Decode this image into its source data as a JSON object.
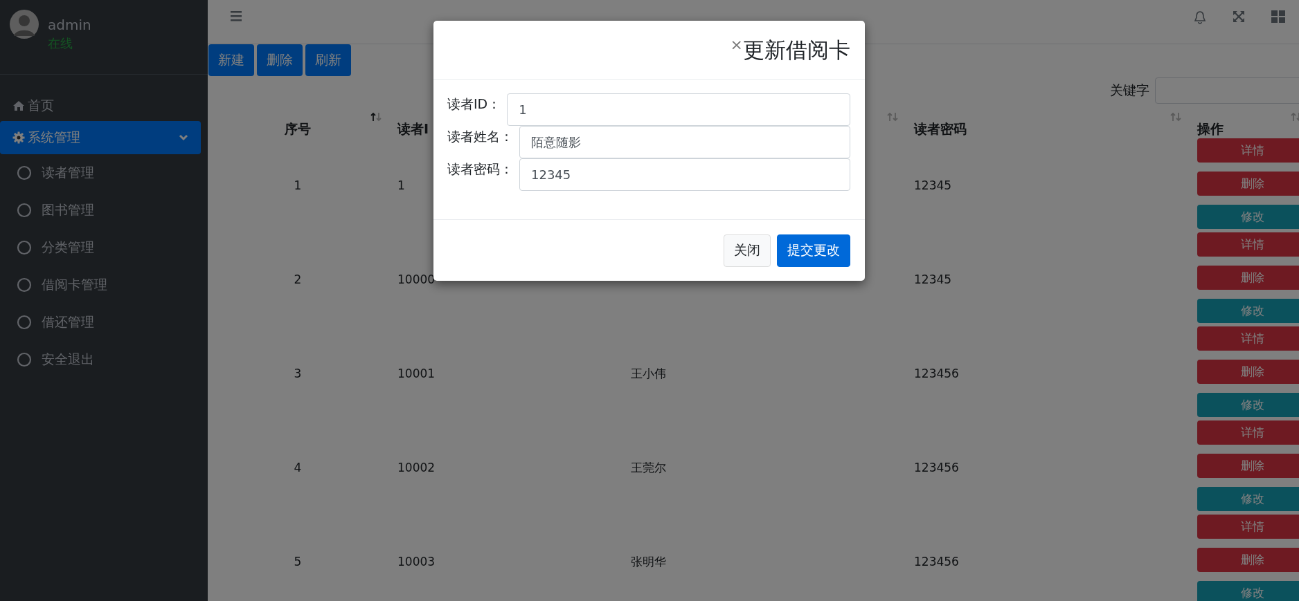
{
  "sidebar": {
    "user": {
      "name": "admin",
      "status": "在线"
    },
    "items": [
      {
        "label": "首页",
        "kind": "link",
        "selected": false
      },
      {
        "label": "系统管理",
        "kind": "group",
        "selected": true,
        "expanded": true,
        "children": [
          {
            "label": "读者管理",
            "selected": false
          },
          {
            "label": "图书管理",
            "selected": false
          },
          {
            "label": "分类管理",
            "selected": false
          },
          {
            "label": "借阅卡管理",
            "selected": false
          },
          {
            "label": "借还管理",
            "selected": false
          },
          {
            "label": "安全退出",
            "selected": false
          }
        ]
      }
    ]
  },
  "toolbar": {
    "buttons": [
      "新建",
      "删除",
      "刷新"
    ]
  },
  "search": {
    "label": "关键字"
  },
  "table": {
    "columns": [
      {
        "label": "序号",
        "sorted": true
      },
      {
        "label": "读者I"
      },
      {
        "sorted": false
      },
      {
        "label": "读者密码",
        "sorted": false
      },
      {
        "label": "操作",
        "sorted": false
      }
    ],
    "rows": [
      {
        "no": "1",
        "reader_id": "1",
        "password": "12345",
        "actions": [
          {
            "label": "详情",
            "kind": "danger"
          },
          {
            "label": "删除",
            "kind": "danger"
          },
          {
            "label": "修改",
            "kind": "info"
          }
        ]
      },
      {
        "no": "2",
        "reader_id": "10000",
        "password": "12345",
        "actions": [
          {
            "label": "详情",
            "kind": "danger"
          },
          {
            "label": "删除",
            "kind": "danger"
          },
          {
            "label": "修改",
            "kind": "info"
          }
        ]
      },
      {
        "no": "3",
        "reader_id": "10001",
        "name": "王小伟",
        "password": "123456",
        "actions": [
          {
            "label": "详情",
            "kind": "danger"
          },
          {
            "label": "删除",
            "kind": "danger"
          },
          {
            "label": "修改",
            "kind": "info"
          }
        ]
      },
      {
        "no": "4",
        "reader_id": "10002",
        "name": "王莞尔",
        "password": "123456",
        "actions": [
          {
            "label": "详情",
            "kind": "danger"
          },
          {
            "label": "删除",
            "kind": "danger"
          },
          {
            "label": "修改",
            "kind": "info"
          }
        ]
      },
      {
        "no": "5",
        "reader_id": "10003",
        "name": "张明华",
        "password": "123456",
        "actions": [
          {
            "label": "详情",
            "kind": "danger"
          },
          {
            "label": "删除",
            "kind": "danger"
          },
          {
            "label": "修改",
            "kind": "info"
          }
        ]
      }
    ]
  },
  "modal": {
    "close": "×",
    "title": "更新借阅卡",
    "fields": [
      {
        "label": "读者ID：",
        "value": "1"
      },
      {
        "label": "读者姓名：",
        "value": "陌意随影"
      },
      {
        "label": "读者密码：",
        "value": "12345"
      }
    ],
    "buttons": [
      {
        "label": "关闭",
        "kind": "secondary"
      },
      {
        "label": "提交更改",
        "kind": "primary"
      }
    ]
  }
}
